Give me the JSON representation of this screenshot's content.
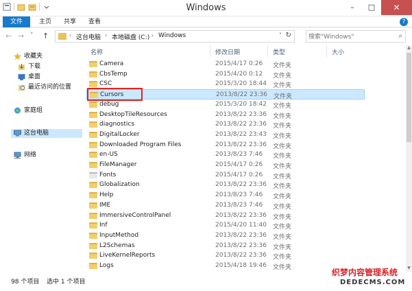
{
  "window": {
    "title": "Windows",
    "minimize_glyph": "–",
    "maximize_glyph": "□",
    "close_glyph": "✕"
  },
  "quick_access": {
    "icons": [
      "properties-icon",
      "new-folder-icon",
      "dropdown-icon"
    ]
  },
  "ribbon": {
    "tabs": [
      "文件",
      "主页",
      "共享",
      "查看"
    ],
    "expand_glyph": "?"
  },
  "nav": {
    "back_glyph": "←",
    "forward_glyph": "→",
    "history_glyph": "˅",
    "up_glyph": "↑",
    "breadcrumbs": [
      "这台电脑",
      "本地磁盘 (C:)",
      "Windows"
    ],
    "crumb_sep": "›",
    "dropdown_glyph": "˅",
    "refresh_glyph": "↻",
    "search_placeholder": "搜索\"Windows\"",
    "search_glyph": "⌕"
  },
  "navpane": {
    "favorites": "收藏夹",
    "downloads": "下载",
    "desktop": "桌面",
    "recent": "最近访问的位置",
    "homegroup": "家庭组",
    "thispc": "这台电脑",
    "network": "网络"
  },
  "columns": {
    "name": "名称",
    "date": "修改日期",
    "type": "类型",
    "size": "大小"
  },
  "files": [
    {
      "name": "Camera",
      "date": "2015/4/17 0:26",
      "type": "文件夹"
    },
    {
      "name": "CbsTemp",
      "date": "2015/4/20 0:12",
      "type": "文件夹"
    },
    {
      "name": "CSC",
      "date": "2015/3/20 18:44",
      "type": "文件夹"
    },
    {
      "name": "Cursors",
      "date": "2013/8/22 23:36",
      "type": "文件夹"
    },
    {
      "name": "debug",
      "date": "2015/3/20 18:42",
      "type": "文件夹"
    },
    {
      "name": "DesktopTileResources",
      "date": "2013/8/22 23:36",
      "type": "文件夹"
    },
    {
      "name": "diagnostics",
      "date": "2013/8/22 23:36",
      "type": "文件夹"
    },
    {
      "name": "DigitalLocker",
      "date": "2013/8/22 23:43",
      "type": "文件夹"
    },
    {
      "name": "Downloaded Program Files",
      "date": "2013/8/22 23:36",
      "type": "文件夹"
    },
    {
      "name": "en-US",
      "date": "2013/8/23 7:46",
      "type": "文件夹"
    },
    {
      "name": "FileManager",
      "date": "2015/4/17 0:26",
      "type": "文件夹"
    },
    {
      "name": "Fonts",
      "date": "2015/4/17 0:26",
      "type": "文件夹"
    },
    {
      "name": "Globalization",
      "date": "2013/8/22 23:36",
      "type": "文件夹"
    },
    {
      "name": "Help",
      "date": "2013/8/23 7:46",
      "type": "文件夹"
    },
    {
      "name": "IME",
      "date": "2013/8/23 7:46",
      "type": "文件夹"
    },
    {
      "name": "ImmersiveControlPanel",
      "date": "2013/8/22 23:36",
      "type": "文件夹"
    },
    {
      "name": "Inf",
      "date": "2015/4/20 11:40",
      "type": "文件夹"
    },
    {
      "name": "InputMethod",
      "date": "2013/8/22 23:36",
      "type": "文件夹"
    },
    {
      "name": "L2Schemas",
      "date": "2013/8/22 23:36",
      "type": "文件夹"
    },
    {
      "name": "LiveKernelReports",
      "date": "2013/8/22 23:36",
      "type": "文件夹"
    },
    {
      "name": "Logs",
      "date": "2015/4/18 19:46",
      "type": "文件夹"
    }
  ],
  "status": {
    "count": "98 个项目",
    "selected": "选中 1 个项目"
  },
  "watermark": {
    "line1": "织梦内容管理系统",
    "line2": "DEDECMS.COM"
  },
  "colors": {
    "accent": "#1979ca",
    "selection": "#cce8ff",
    "highlight_border": "#e0241f",
    "folder": "#f2cf6a"
  }
}
